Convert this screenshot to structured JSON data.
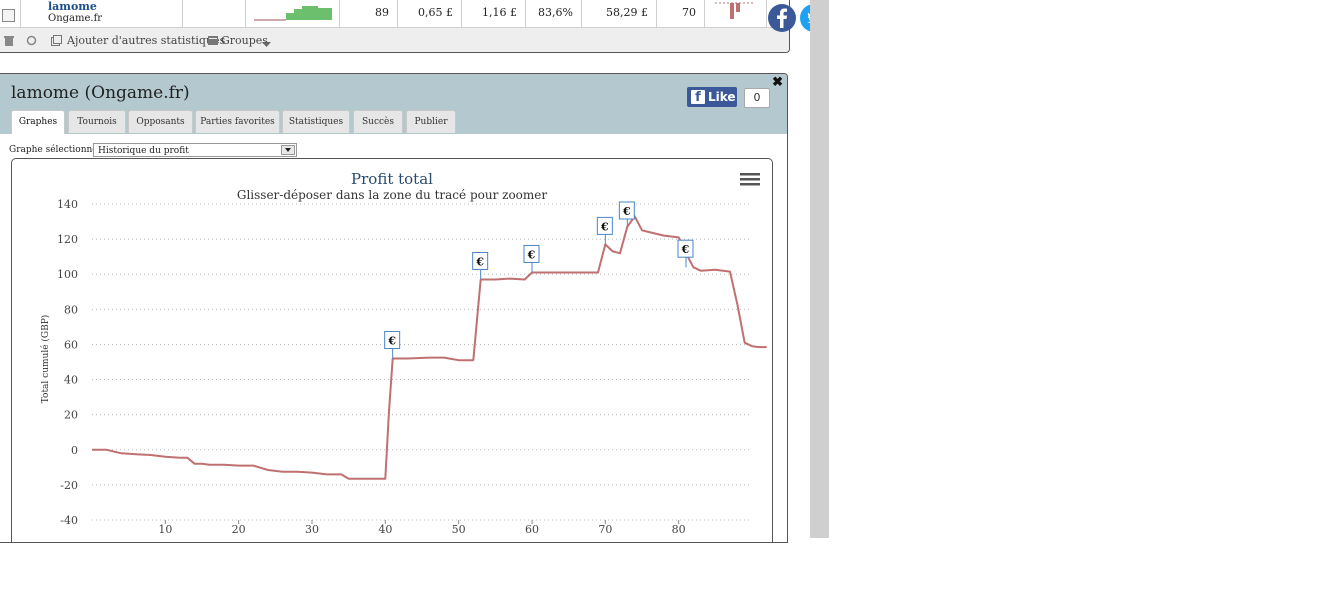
{
  "top_table": {
    "row": {
      "player_name": "lamome",
      "network": "Ongame.fr",
      "cells": [
        "89",
        "0,65 £",
        "1,16 £",
        "83,6%",
        "58,29 £",
        "70"
      ]
    },
    "toolbar": {
      "add_stats_label": "Ajouter d'autres statistiques",
      "groups_label": "Groupes"
    }
  },
  "panel": {
    "title": "lamome (Ongame.fr)",
    "close_symbol": "✖",
    "like_label": "Like",
    "like_count": "0",
    "tabs": [
      {
        "label": "Graphes",
        "active": true
      },
      {
        "label": "Tournois",
        "active": false
      },
      {
        "label": "Opposants",
        "active": false
      },
      {
        "label": "Parties favorites",
        "active": false
      },
      {
        "label": "Statistiques",
        "active": false
      },
      {
        "label": "Succès",
        "active": false
      },
      {
        "label": "Publier",
        "active": false
      }
    ],
    "graph_select_label": "Graphe sélectionné :",
    "graph_select_value": "Historique du profit"
  },
  "colors": {
    "line": "#c07070",
    "marker": "#4a86c8",
    "header_bg": "#b4c9cf",
    "facebook": "#3b5998",
    "twitter": "#1da1f2"
  },
  "chart_data": {
    "type": "line",
    "title": "Profit total",
    "subtitle": "Glisser-déposer dans la zone du tracé pour zoomer",
    "ylabel": "Total cumulé (GBP)",
    "xlabel": "",
    "xlim": [
      0,
      90
    ],
    "ylim": [
      -40,
      140
    ],
    "x_ticks": [
      10,
      20,
      30,
      40,
      50,
      60,
      70,
      80
    ],
    "y_ticks": [
      -40,
      -20,
      0,
      20,
      40,
      60,
      80,
      100,
      120,
      140
    ],
    "grid": "horizontal-dotted",
    "series": [
      {
        "points": [
          [
            0,
            0
          ],
          [
            2,
            0
          ],
          [
            4,
            -2
          ],
          [
            6,
            -2.5
          ],
          [
            8,
            -3
          ],
          [
            10,
            -4
          ],
          [
            12,
            -4.5
          ],
          [
            13,
            -4.5
          ],
          [
            14,
            -8
          ],
          [
            15,
            -8
          ],
          [
            16,
            -8.5
          ],
          [
            18,
            -8.5
          ],
          [
            20,
            -9
          ],
          [
            22,
            -9
          ],
          [
            24,
            -11.5
          ],
          [
            26,
            -12.5
          ],
          [
            28,
            -12.5
          ],
          [
            30,
            -13
          ],
          [
            32,
            -14
          ],
          [
            34,
            -14
          ],
          [
            35,
            -16.5
          ],
          [
            36,
            -16.5
          ],
          [
            38,
            -16.5
          ],
          [
            40,
            -16.5
          ],
          [
            40.5,
            22
          ],
          [
            41,
            52
          ],
          [
            43,
            52
          ],
          [
            46,
            52.5
          ],
          [
            48,
            52.5
          ],
          [
            50,
            51
          ],
          [
            52,
            51
          ],
          [
            53,
            97
          ],
          [
            55,
            97
          ],
          [
            57,
            97.5
          ],
          [
            59,
            97
          ],
          [
            60,
            101
          ],
          [
            62,
            101
          ],
          [
            69,
            101
          ],
          [
            70,
            117
          ],
          [
            71,
            113
          ],
          [
            72,
            112
          ],
          [
            73,
            127
          ],
          [
            74,
            133
          ],
          [
            75,
            125
          ],
          [
            76,
            124
          ],
          [
            78,
            122
          ],
          [
            80,
            121
          ],
          [
            81,
            112
          ],
          [
            82,
            104
          ],
          [
            83,
            102
          ],
          [
            85,
            102.5
          ],
          [
            87,
            101.5
          ],
          [
            88,
            83
          ],
          [
            89,
            61
          ],
          [
            90,
            59
          ],
          [
            91,
            58.5
          ],
          [
            92,
            58.5
          ]
        ]
      }
    ],
    "flags": [
      {
        "x": 41,
        "y": 52,
        "label": "€"
      },
      {
        "x": 53,
        "y": 97,
        "label": "€"
      },
      {
        "x": 60,
        "y": 101,
        "label": "€"
      },
      {
        "x": 70,
        "y": 117,
        "label": "€"
      },
      {
        "x": 73,
        "y": 127,
        "label": "€"
      },
      {
        "x": 81,
        "y": 104,
        "label": "€"
      }
    ]
  }
}
